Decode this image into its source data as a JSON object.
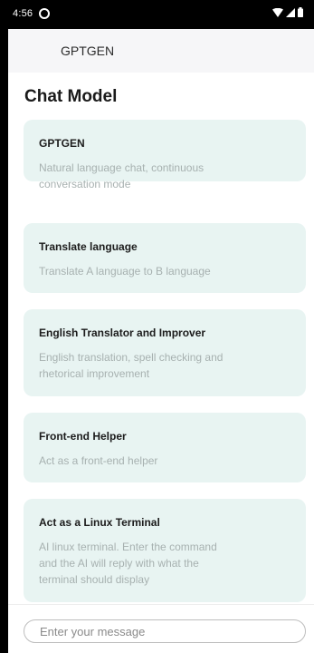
{
  "status_bar": {
    "time": "4:56",
    "icons": [
      "notification-icon",
      "wifi-icon",
      "signal-icon",
      "battery-icon"
    ]
  },
  "app_bar": {
    "title": "GPTGEN"
  },
  "section": {
    "title": "Chat Model"
  },
  "models": [
    {
      "title": "GPTGEN",
      "description_lines": [
        "Natural language chat, continuous",
        "conversation mode"
      ]
    },
    {
      "title": "Translate language",
      "description_lines": [
        "Translate A language to B language"
      ]
    },
    {
      "title": "English Translator and Improver",
      "description_lines": [
        "English translation, spell checking and",
        "rhetorical improvement"
      ]
    },
    {
      "title": "Front-end Helper",
      "description_lines": [
        "Act as a front-end helper"
      ]
    },
    {
      "title": "Act as a Linux Terminal",
      "description_lines": [
        "AI linux terminal. Enter the command",
        "and the AI will reply with what the",
        "terminal should display"
      ]
    }
  ],
  "composer": {
    "value": "",
    "placeholder": "Enter your message"
  },
  "colors": {
    "card_background": "#e8f4f2",
    "app_bar_background": "#f6f6f8",
    "description_text": "#a7b1b0"
  }
}
